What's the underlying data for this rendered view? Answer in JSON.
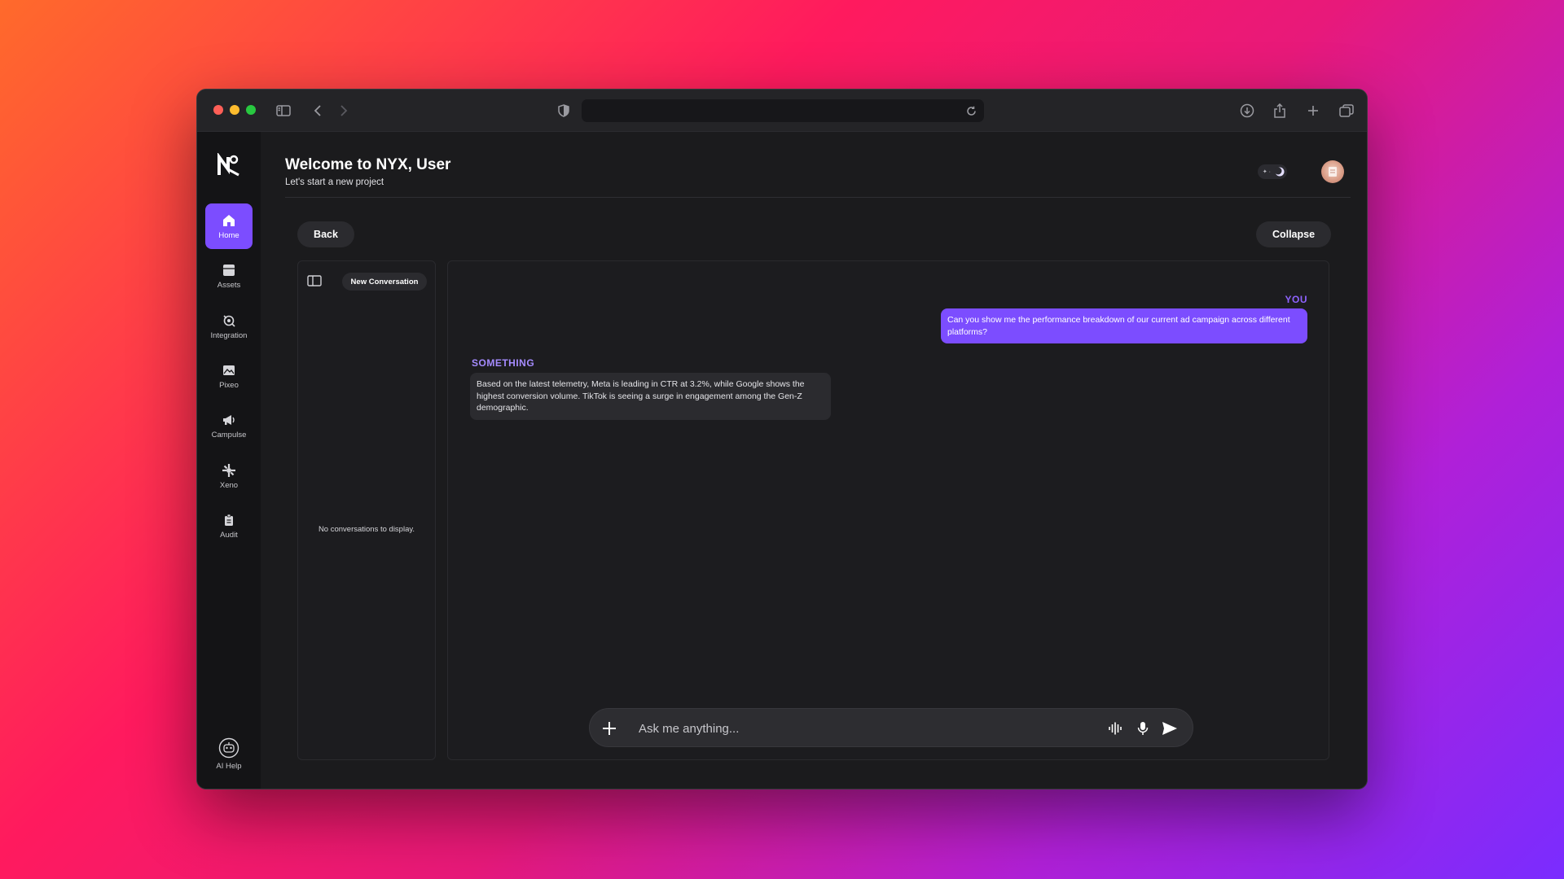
{
  "browser": {
    "url": "",
    "icons": [
      "sidebar-toggle-icon",
      "back-arrow-icon",
      "forward-arrow-icon",
      "shield-icon",
      "reload-icon",
      "download-icon",
      "share-icon",
      "new-tab-icon",
      "tabs-overview-icon"
    ]
  },
  "sidebar": {
    "items": [
      {
        "label": "Home",
        "icon": "home-icon",
        "active": true
      },
      {
        "label": "Assets",
        "icon": "assets-icon"
      },
      {
        "label": "Integration",
        "icon": "integration-icon"
      },
      {
        "label": "Pixeo",
        "icon": "image-icon"
      },
      {
        "label": "Campulse",
        "icon": "megaphone-icon"
      },
      {
        "label": "Xeno",
        "icon": "xeno-icon"
      },
      {
        "label": "Audit",
        "icon": "audit-icon"
      }
    ],
    "help": {
      "label": "AI Help",
      "icon": "ai-help-icon"
    }
  },
  "header": {
    "title": "Welcome to NYX, User",
    "subtitle": "Let's start a new project"
  },
  "actions": {
    "back_label": "Back",
    "collapse_label": "Collapse"
  },
  "conversations": {
    "new_label": "New Conversation",
    "empty_text": "No conversations to display."
  },
  "chat": {
    "user_label": "YOU",
    "user_message": "Can you show me the performance breakdown of our current ad campaign across different platforms?",
    "bot_label": "SOMETHING",
    "bot_message": "Based on the latest telemetry, Meta is leading in CTR at 3.2%, while Google shows the highest conversion volume. TikTok is seeing a surge in engagement among the Gen-Z demographic."
  },
  "composer": {
    "placeholder": "Ask me anything..."
  },
  "colors": {
    "accent": "#7c4dff",
    "background": "#1b1b1d"
  }
}
